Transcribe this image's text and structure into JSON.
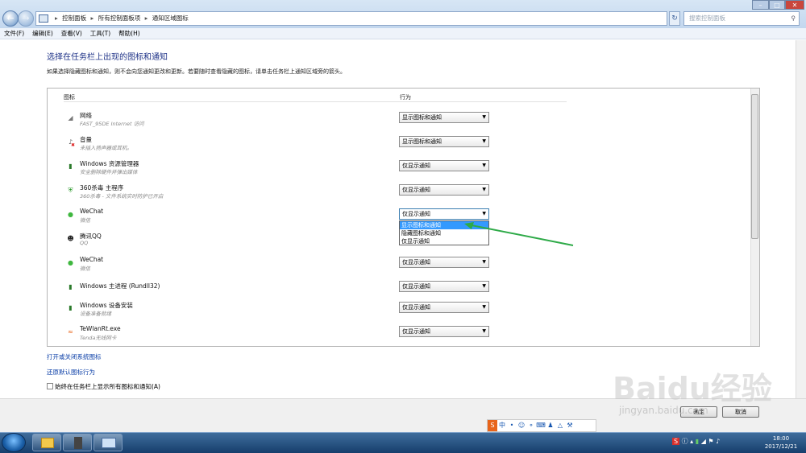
{
  "address": {
    "crumbs": [
      "控制面板",
      "所有控制面板项",
      "通知区域图标"
    ],
    "search_placeholder": "搜索控制面板"
  },
  "menu": [
    "文件(F)",
    "编辑(E)",
    "查看(V)",
    "工具(T)",
    "帮助(H)"
  ],
  "page": {
    "title": "选择在任务栏上出现的图标和通知",
    "description": "如果选择隐藏图标和通知，则不会向您通知更改和更新。若要随时查看隐藏的图标，请单击任务栏上通知区域旁的箭头。",
    "col_icon": "图标",
    "col_behavior": "行为"
  },
  "rows": [
    {
      "name": "网络",
      "sub": "FAST_95DE Internet 访问",
      "value": "显示图标和通知",
      "icon": "network-icon"
    },
    {
      "name": "音量",
      "sub": "未插入扬声器或耳机。",
      "value": "显示图标和通知",
      "icon": "volume-muted-icon"
    },
    {
      "name": "Windows 资源管理器",
      "sub": "安全删除硬件并弹出媒体",
      "value": "仅显示通知",
      "icon": "usb-icon"
    },
    {
      "name": "360杀毒 主程序",
      "sub": "360杀毒 - 文件系统实时防护已开启",
      "value": "仅显示通知",
      "icon": "shield-icon"
    },
    {
      "name": "WeChat",
      "sub": "微信",
      "value": "仅显示通知",
      "icon": "wechat-icon"
    },
    {
      "name": "腾讯QQ",
      "sub": "QQ",
      "value": "",
      "icon": "qq-icon"
    },
    {
      "name": "WeChat",
      "sub": "微信",
      "value": "仅显示通知",
      "icon": "wechat-icon"
    },
    {
      "name": "Windows 主进程 (Rundll32)",
      "sub": "",
      "value": "仅显示通知",
      "icon": "rundll-icon"
    },
    {
      "name": "Windows 设备安装",
      "sub": "设备准备就绪",
      "value": "仅显示通知",
      "icon": "device-install-icon"
    },
    {
      "name": "TeWlanRt.exe",
      "sub": "Tenda无线网卡",
      "value": "仅显示通知",
      "icon": "wifi-icon"
    }
  ],
  "dropdown_options": [
    "显示图标和通知",
    "隐藏图标和通知",
    "仅显示通知"
  ],
  "links": {
    "system_icons": "打开或关闭系统图标",
    "restore": "还原默认图标行为"
  },
  "checkbox_label": "始终在任务栏上显示所有图标和通知(A)",
  "buttons": {
    "ok": "确定",
    "cancel": "取消"
  },
  "clock": {
    "time": "18:00",
    "date": "2017/12/21"
  },
  "ime": {
    "lang": "中"
  },
  "watermark": {
    "brand": "Baidu经验",
    "url": "jingyan.baidu.com"
  },
  "colors": {
    "link": "#0a3ea7",
    "heading": "#1e3287",
    "selection": "#3399ff",
    "annotation": "#2eaa48"
  }
}
